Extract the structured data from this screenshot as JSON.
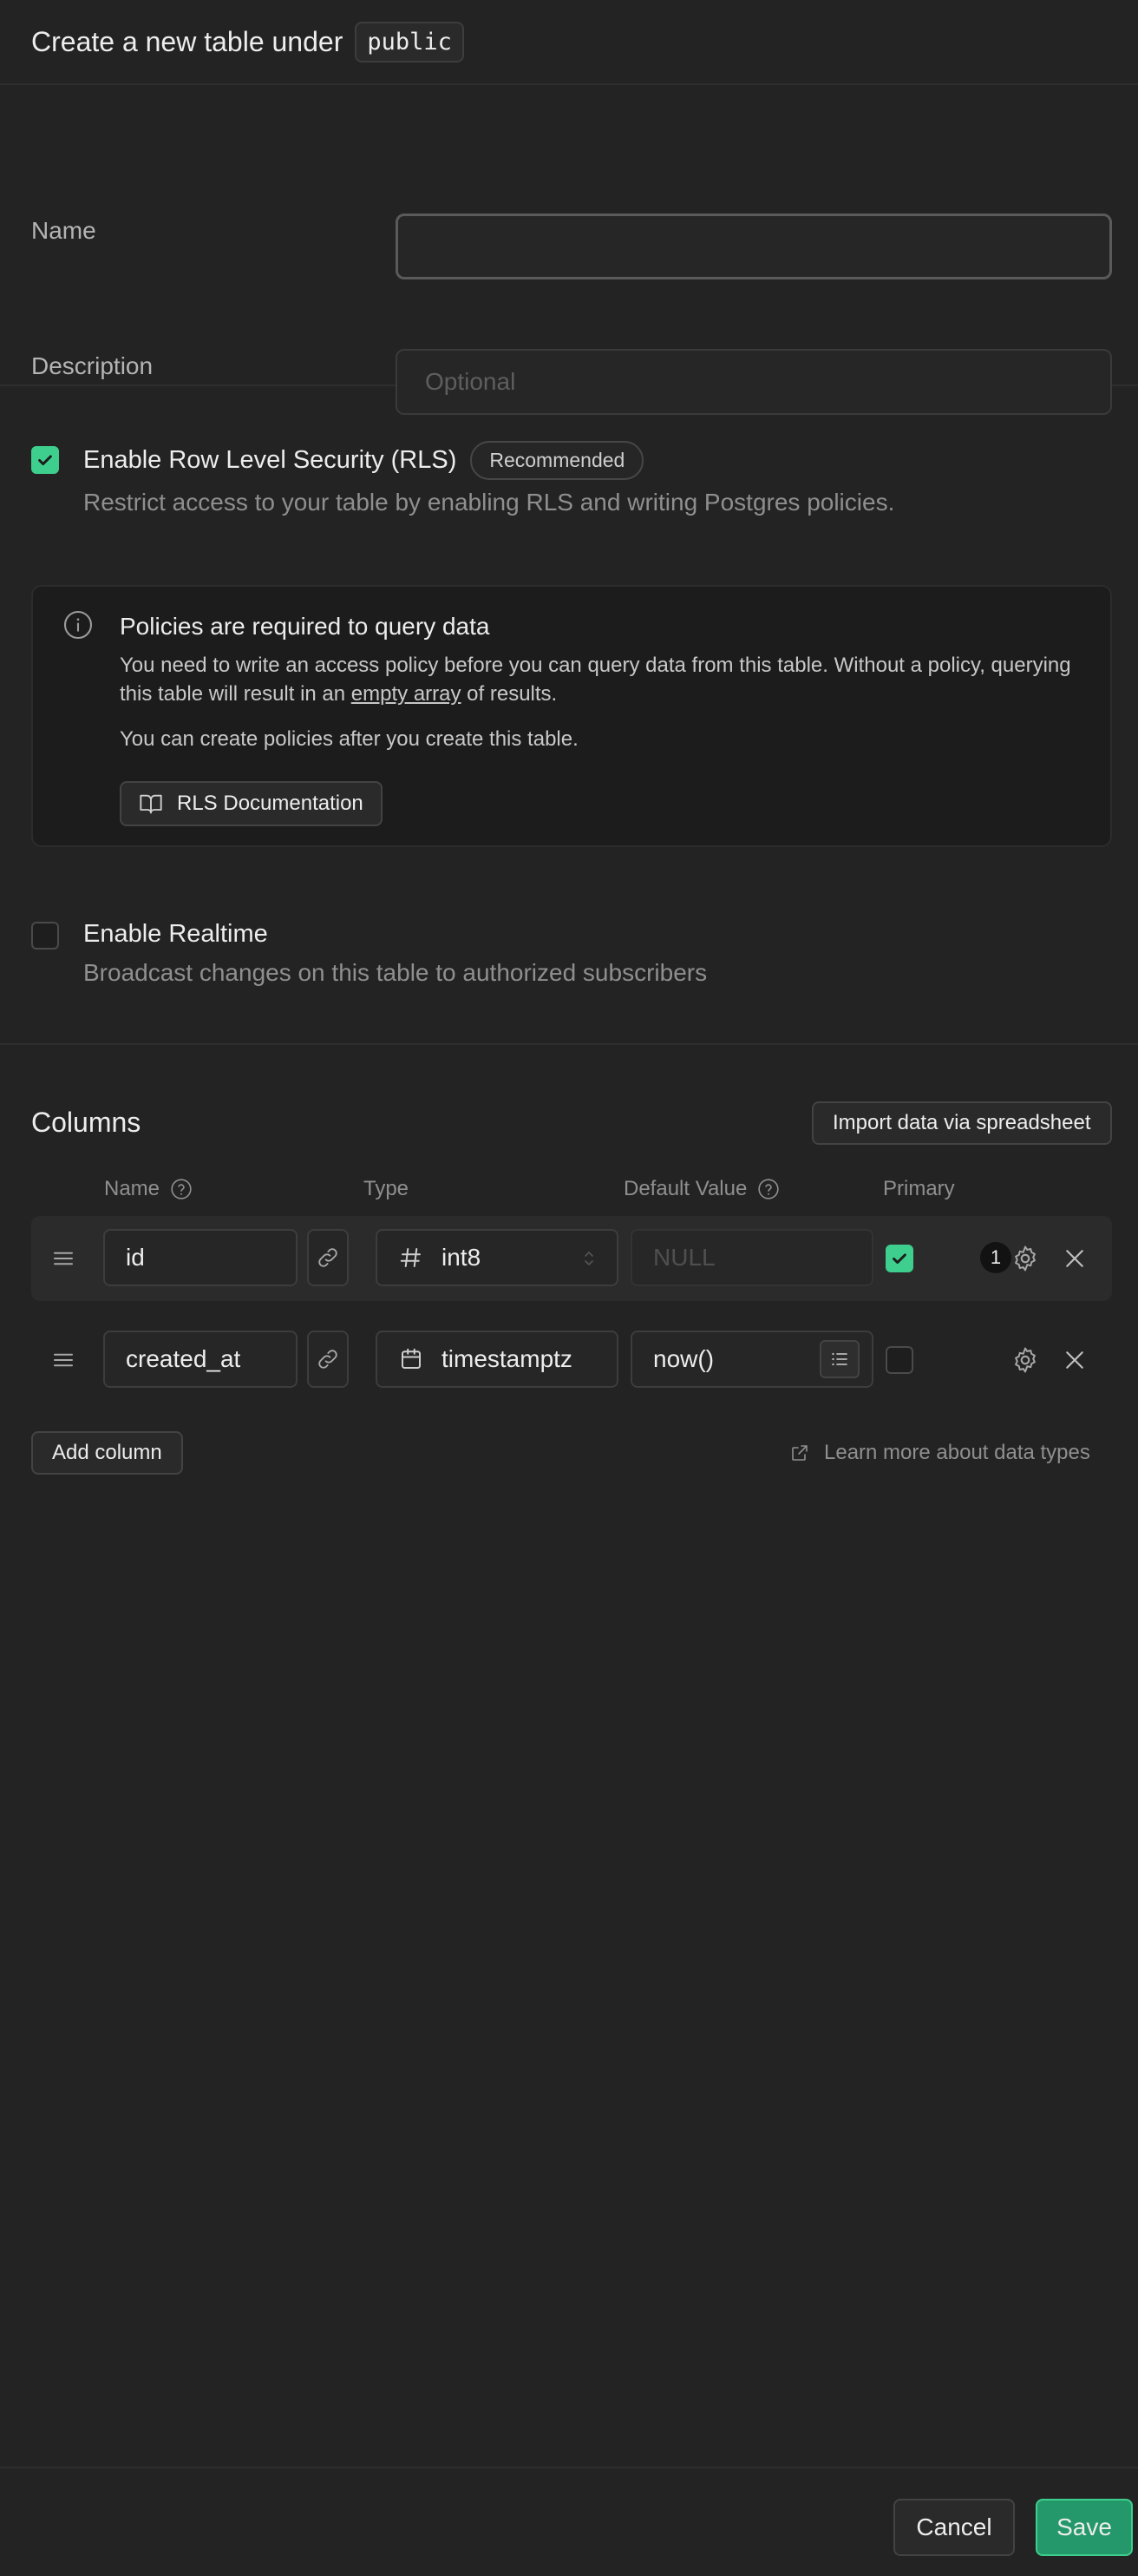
{
  "header": {
    "title": "Create a new table under",
    "schema": "public"
  },
  "form": {
    "name_label": "Name",
    "name_value": "",
    "description_label": "Description",
    "description_placeholder": "Optional"
  },
  "rls": {
    "checked": true,
    "title": "Enable Row Level Security (RLS)",
    "badge": "Recommended",
    "description": "Restrict access to your table by enabling RLS and writing Postgres policies."
  },
  "alert": {
    "title": "Policies are required to query data",
    "body_pre": "You need to write an access policy before you can query data from this table. Without a policy, querying this table will result in an ",
    "body_link": "empty array",
    "body_post": " of results.",
    "body2": "You can create policies after you create this table.",
    "doc_button": "RLS Documentation"
  },
  "realtime": {
    "checked": false,
    "title": "Enable Realtime",
    "description": "Broadcast changes on this table to authorized subscribers"
  },
  "columns": {
    "title": "Columns",
    "import_button": "Import data via spreadsheet",
    "headers": {
      "name": "Name",
      "type": "Type",
      "default": "Default Value",
      "primary": "Primary"
    },
    "rows": [
      {
        "name": "id",
        "type": "int8",
        "type_icon": "hash-icon",
        "default": "NULL",
        "primary": true,
        "badge": "1"
      },
      {
        "name": "created_at",
        "type": "timestamptz",
        "type_icon": "calendar-icon",
        "default": "now()",
        "primary": false
      }
    ],
    "add_button": "Add column",
    "learn_more": "Learn more about data types"
  },
  "footer": {
    "cancel": "Cancel",
    "save": "Save"
  },
  "colors": {
    "accent": "#3ecf8e",
    "save_bg": "#24986a"
  }
}
